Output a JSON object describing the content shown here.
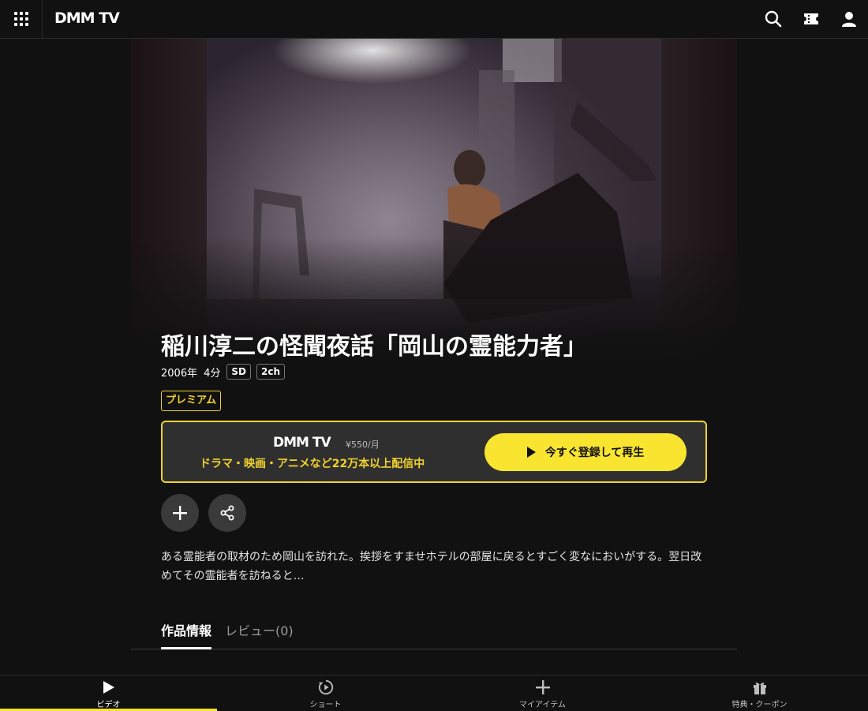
{
  "header": {
    "logo": "DMM TV",
    "icons": [
      "grid-menu-icon",
      "search-icon",
      "ticket-icon",
      "user-icon"
    ]
  },
  "hero": {
    "image_desc_icon": "hero-image"
  },
  "title": "稲川淳二の怪聞夜話「岡山の霊能力者」",
  "meta": {
    "year": "2006年",
    "duration": "4分",
    "quality": "SD",
    "audio": "2ch"
  },
  "premium_label": "プレミアム",
  "promo": {
    "logo": "DMM TV",
    "price": "¥550/月",
    "message": "ドラマ・映画・アニメなど22万本以上配信中",
    "cta_label": "今すぐ登録して再生"
  },
  "description": "ある霊能者の取材のため岡山を訪れた。挨拶をすませホテルの部屋に戻るとすごく変なにおいがする。翌日改めてその霊能者を訪ねると…",
  "tabs": [
    {
      "label": "作品情報",
      "active": true
    },
    {
      "label": "レビュー(0)",
      "active": false
    }
  ],
  "bottom_nav": [
    {
      "label": "ビデオ",
      "icon": "play-icon",
      "active": true
    },
    {
      "label": "ショート",
      "icon": "short-play-icon",
      "active": false
    },
    {
      "label": "マイアイテム",
      "icon": "plus-icon",
      "active": false
    },
    {
      "label": "特典・クーポン",
      "icon": "gift-icon",
      "active": false
    }
  ],
  "colors": {
    "background": "#111111",
    "accent_yellow": "#f9e530",
    "promo_border": "#f2d22e",
    "promo_bg": "#2f2f2f"
  }
}
